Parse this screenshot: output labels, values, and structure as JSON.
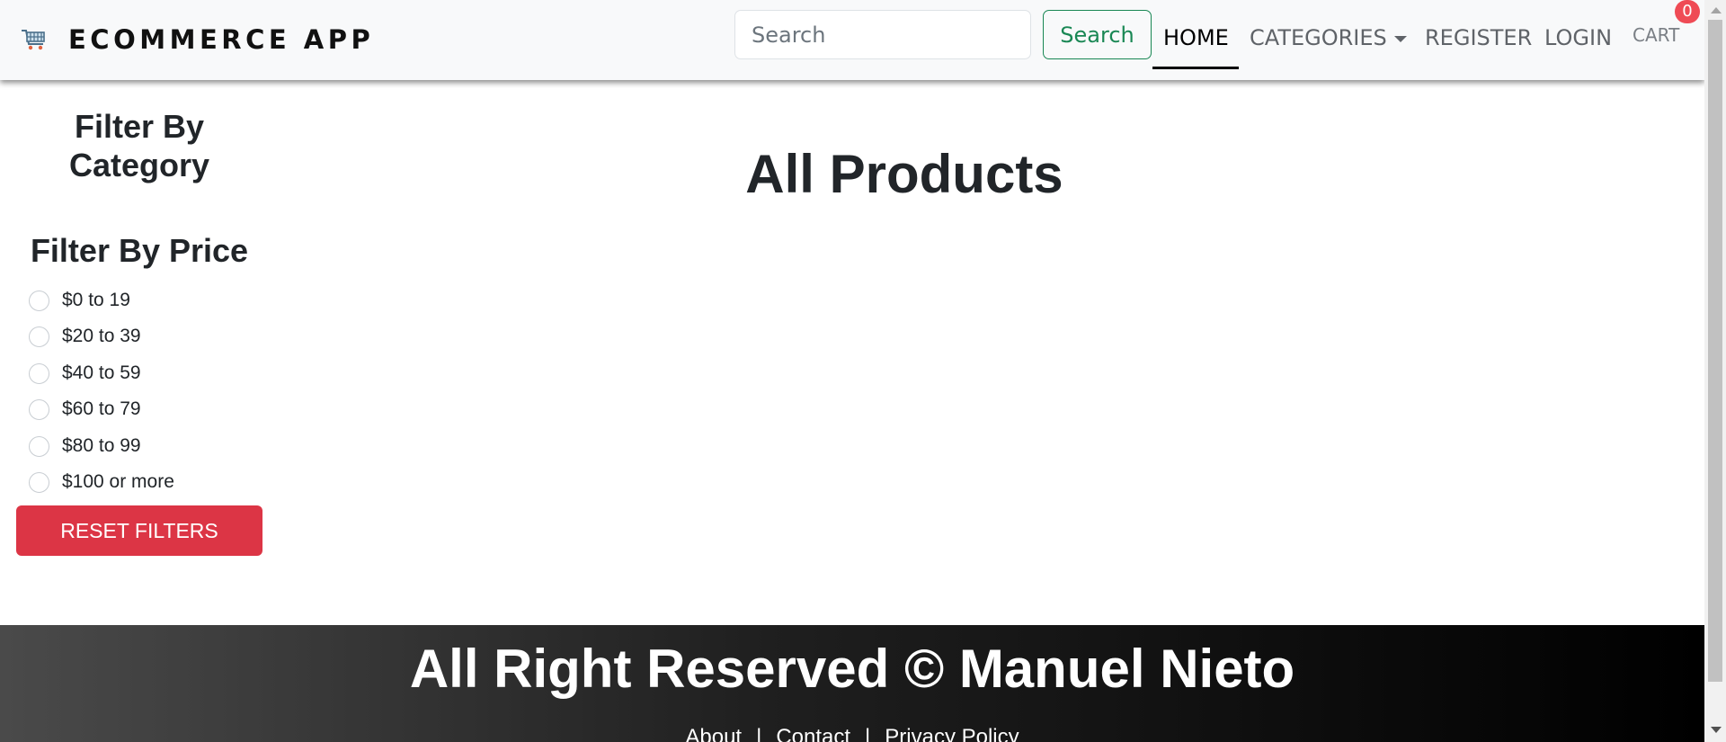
{
  "navbar": {
    "brand_icon": "shopping-cart-icon",
    "brand": "ECOMMERCE APP",
    "search_placeholder": "Search",
    "search_button": "Search",
    "links": {
      "home": "HOME",
      "categories": "CATEGORIES",
      "register": "REGISTER",
      "login": "LOGIN",
      "cart": "CART"
    },
    "cart_count": "0"
  },
  "sidebar": {
    "category_title": "Filter By Category",
    "price_title": "Filter By Price",
    "price_options": [
      "$0 to 19",
      "$20 to 39",
      "$40 to 59",
      "$60 to 79",
      "$80 to 99",
      "$100 or more"
    ],
    "reset_button": "RESET FILTERS"
  },
  "main": {
    "title": "All Products"
  },
  "footer": {
    "copyright": "All Right Reserved © Manuel Nieto",
    "links": [
      "About",
      "Contact",
      "Privacy Policy"
    ],
    "separator": "|"
  },
  "colors": {
    "navbar_bg": "#f8f9fa",
    "search_green": "#198754",
    "reset_red": "#dc3545",
    "badge_red": "#ef4b55",
    "footer_start": "#4a4a4a",
    "footer_end": "#000000"
  }
}
